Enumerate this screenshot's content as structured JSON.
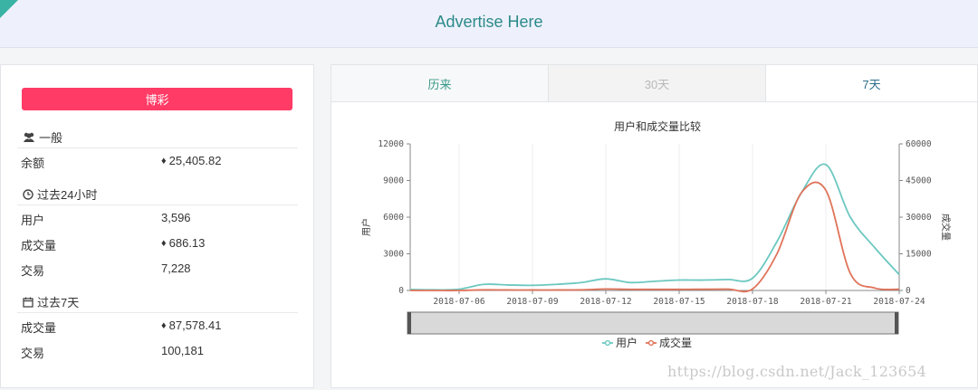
{
  "banner": {
    "title": "Advertise Here"
  },
  "colors": {
    "users": "#6cc8c0",
    "volume": "#e0735a",
    "button": "#ff3b66",
    "accent": "#3a9a8a"
  },
  "left": {
    "button_label": "博彩",
    "general": {
      "title": "一般",
      "icon": "users-icon",
      "rows": [
        {
          "label": "余额",
          "value": "25,405.82",
          "eth": true
        }
      ]
    },
    "last24h": {
      "title": "过去24小时",
      "icon": "clock-icon",
      "rows": [
        {
          "label": "用户",
          "value": "3,596",
          "eth": false
        },
        {
          "label": "成交量",
          "value": "686.13",
          "eth": true
        },
        {
          "label": "交易",
          "value": "7,228",
          "eth": false
        }
      ]
    },
    "last7d": {
      "title": "过去7天",
      "icon": "calendar-icon",
      "rows": [
        {
          "label": "成交量",
          "value": "87,578.41",
          "eth": true
        },
        {
          "label": "交易",
          "value": "100,181",
          "eth": false
        }
      ]
    }
  },
  "tabs": [
    {
      "label": "历来"
    },
    {
      "label": "30天"
    },
    {
      "label": "7天"
    }
  ],
  "chart_data": {
    "type": "line",
    "title": "用户和成交量比较",
    "ylabel": "用户",
    "ylabel_right": "成交量",
    "ylim": [
      0,
      12000
    ],
    "ylim_right": [
      0,
      60000
    ],
    "yticks": [
      "0",
      "3000",
      "6000",
      "9000",
      "12000"
    ],
    "yticks_right": [
      "0",
      "15000",
      "30000",
      "45000",
      "60000"
    ],
    "xticks": [
      "2018-07-06",
      "2018-07-09",
      "2018-07-12",
      "2018-07-15",
      "2018-07-18",
      "2018-07-21",
      "2018-07-24"
    ],
    "x_start": "2018-07-04",
    "legend": [
      "用户",
      "成交量"
    ],
    "legend_position": "bottom",
    "grid": true,
    "series": [
      {
        "name": "用户",
        "axis": "left",
        "x": [
          0,
          1,
          2,
          3,
          4,
          5,
          6,
          7,
          8,
          9,
          10,
          11,
          12,
          13,
          14,
          15,
          16,
          17,
          18,
          19,
          20
        ],
        "y": [
          80,
          50,
          100,
          500,
          450,
          420,
          500,
          650,
          950,
          650,
          750,
          850,
          850,
          900,
          1000,
          4000,
          8000,
          10300,
          6000,
          3500,
          1300
        ]
      },
      {
        "name": "成交量",
        "axis": "right",
        "x": [
          0,
          1,
          2,
          3,
          4,
          5,
          6,
          7,
          8,
          9,
          10,
          11,
          12,
          13,
          14,
          15,
          16,
          17,
          18,
          19,
          20
        ],
        "y": [
          0,
          0,
          0,
          250,
          200,
          200,
          200,
          250,
          600,
          450,
          450,
          450,
          500,
          550,
          600,
          15000,
          40000,
          41000,
          7000,
          1000,
          500
        ]
      }
    ]
  },
  "watermark": "https://blog.csdn.net/Jack_123654"
}
